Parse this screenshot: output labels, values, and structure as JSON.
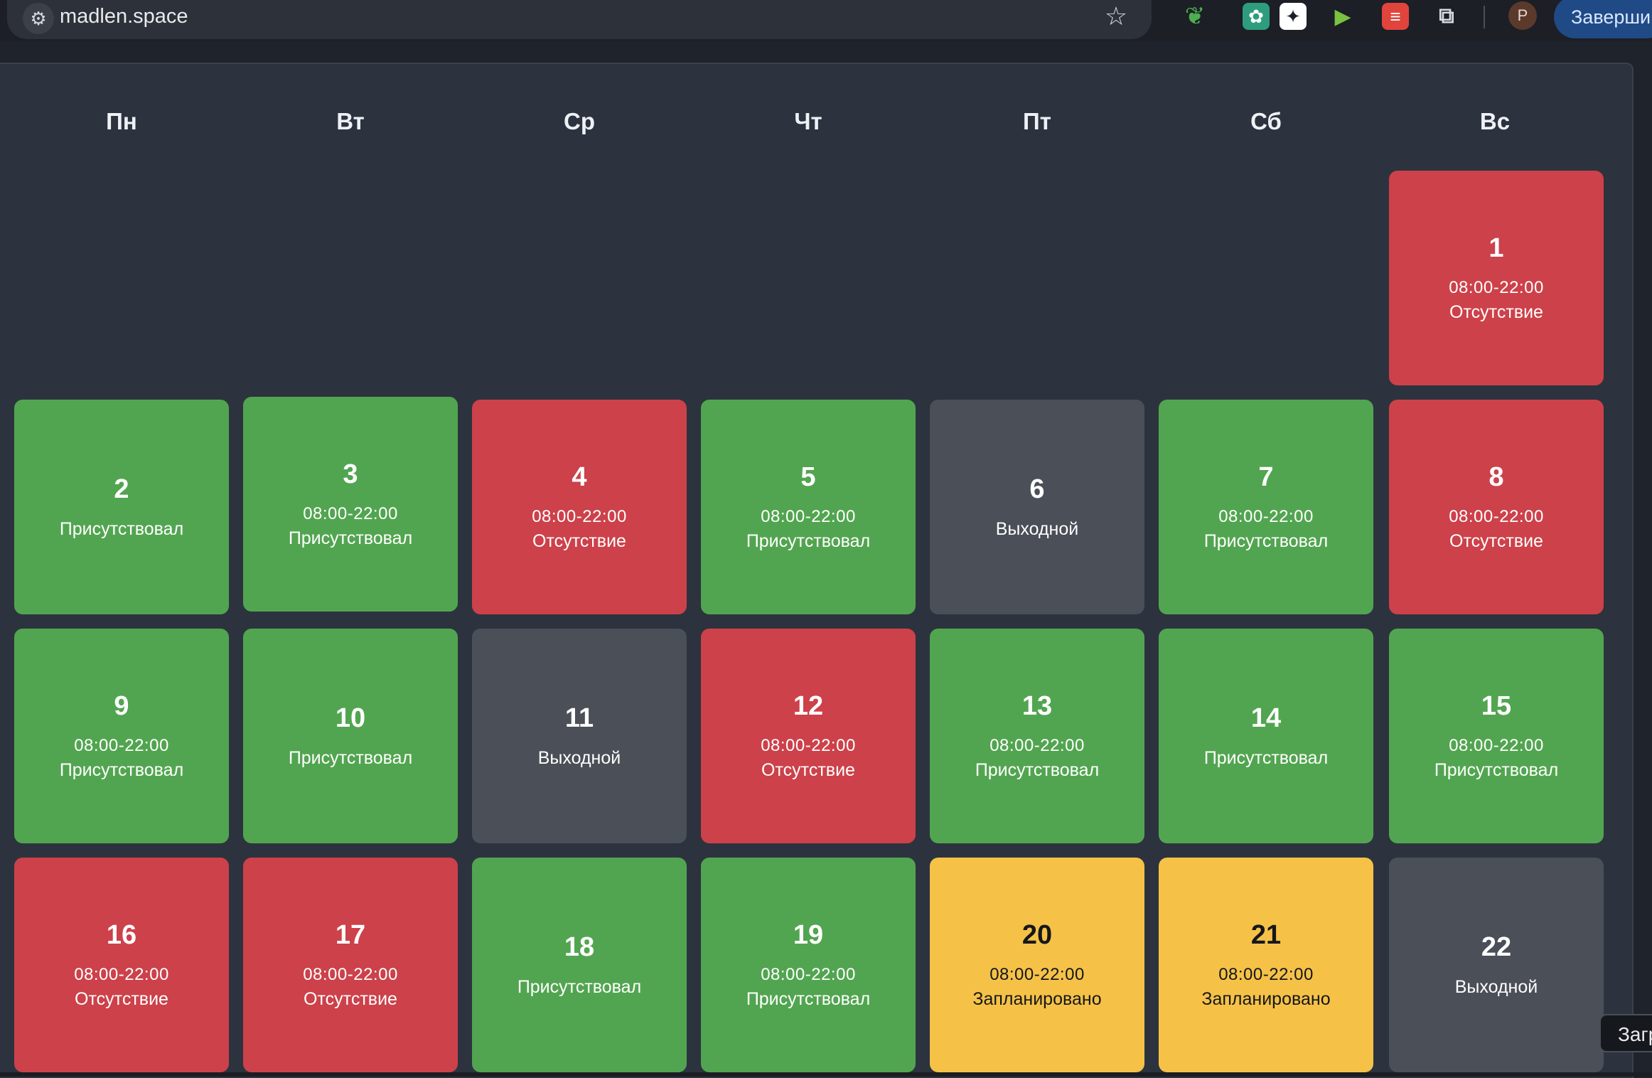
{
  "browser": {
    "url": "madlen.space",
    "finish_button": "Заверши",
    "avatar_letter": "P",
    "extensions": [
      "evernote-icon",
      "chatgpt-icon",
      "gemini-icon",
      "play-icon",
      "todoist-icon",
      "puzzle-icon"
    ]
  },
  "calendar": {
    "weekdays": [
      "Пн",
      "Вт",
      "Ср",
      "Чт",
      "Пт",
      "Сб",
      "Вс"
    ],
    "days": [
      {
        "day": "1",
        "time": "08:00-22:00",
        "status": "Отсутствие"
      },
      {
        "day": "2",
        "time": "",
        "status": "Присутствовал"
      },
      {
        "day": "3",
        "time": "08:00-22:00",
        "status": "Присутствовал"
      },
      {
        "day": "4",
        "time": "08:00-22:00",
        "status": "Отсутствие"
      },
      {
        "day": "5",
        "time": "08:00-22:00",
        "status": "Присутствовал"
      },
      {
        "day": "6",
        "time": "",
        "status": "Выходной"
      },
      {
        "day": "7",
        "time": "08:00-22:00",
        "status": "Присутствовал"
      },
      {
        "day": "8",
        "time": "08:00-22:00",
        "status": "Отсутствие"
      },
      {
        "day": "9",
        "time": "08:00-22:00",
        "status": "Присутствовал"
      },
      {
        "day": "10",
        "time": "",
        "status": "Присутствовал"
      },
      {
        "day": "11",
        "time": "",
        "status": "Выходной"
      },
      {
        "day": "12",
        "time": "08:00-22:00",
        "status": "Отсутствие"
      },
      {
        "day": "13",
        "time": "08:00-22:00",
        "status": "Присутствовал"
      },
      {
        "day": "14",
        "time": "",
        "status": "Присутствовал"
      },
      {
        "day": "15",
        "time": "08:00-22:00",
        "status": "Присутствовал"
      },
      {
        "day": "16",
        "time": "08:00-22:00",
        "status": "Отсутствие"
      },
      {
        "day": "17",
        "time": "08:00-22:00",
        "status": "Отсутствие"
      },
      {
        "day": "18",
        "time": "",
        "status": "Присутствовал"
      },
      {
        "day": "19",
        "time": "08:00-22:00",
        "status": "Присутствовал"
      },
      {
        "day": "20",
        "time": "08:00-22:00",
        "status": "Запланировано"
      },
      {
        "day": "21",
        "time": "08:00-22:00",
        "status": "Запланировано"
      },
      {
        "day": "22",
        "time": "",
        "status": "Выходной"
      }
    ]
  },
  "colors": {
    "present": "#52a550",
    "absent": "#cd414a",
    "day_off": "#4a4f58",
    "planned": "#f5c247"
  },
  "toast_button": "Загр"
}
